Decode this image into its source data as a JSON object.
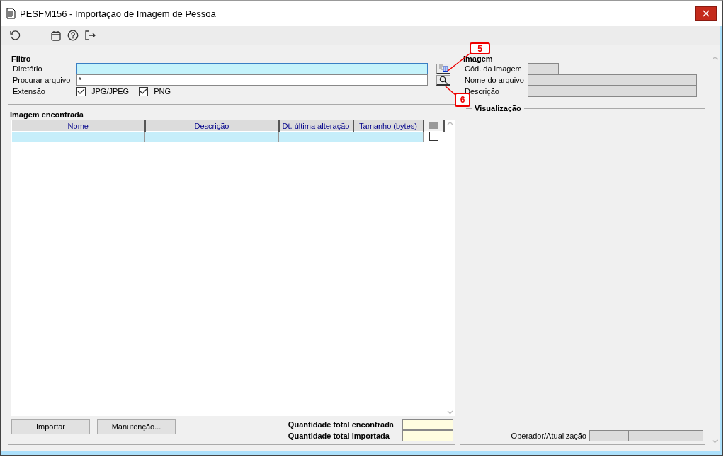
{
  "window": {
    "title": "PESFM156 - Importação de Imagem de Pessoa"
  },
  "filter": {
    "title": "Filtro",
    "directory": {
      "label": "Diretório",
      "focused": true
    },
    "search": {
      "label": "Procurar arquivo",
      "value": "*"
    },
    "extension": {
      "label": "Extensão",
      "options": [
        {
          "label": "JPG/JPEG",
          "checked": true
        },
        {
          "label": "PNG",
          "checked": true
        }
      ]
    }
  },
  "found": {
    "title": "Imagem encontrada",
    "columns": [
      "Nome",
      "Descrição",
      "Dt. última alteração",
      "Tamanho (bytes)"
    ],
    "rows": [
      {
        "selected": true,
        "checked": false
      }
    ],
    "buttons": [
      "Importar",
      "Manutenção..."
    ],
    "totals": [
      {
        "label": "Quantidade total encontrada"
      },
      {
        "label": "Quantidade total importada"
      }
    ]
  },
  "image": {
    "title": "Imagem",
    "fields": [
      {
        "label": "Cód. da imagem"
      },
      {
        "label": "Nome do arquivo"
      },
      {
        "label": "Descrição"
      }
    ],
    "preview_title": "Visualização",
    "operator_label": "Operador/Atualização"
  },
  "callouts": [
    {
      "label": "5"
    },
    {
      "label": "6"
    }
  ]
}
